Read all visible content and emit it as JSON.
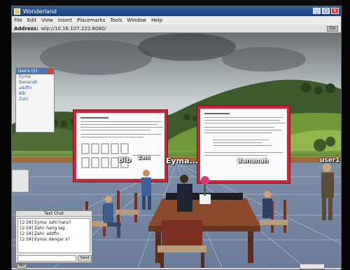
{
  "window": {
    "title": "Wonderland",
    "buttons": {
      "minimize": "_",
      "maximize": "□",
      "close": "x"
    }
  },
  "menu": {
    "items": [
      "File",
      "Edit",
      "View",
      "Insert",
      "Placemarks",
      "Tools",
      "Window",
      "Help"
    ]
  },
  "address": {
    "label": "Address:",
    "value": "wlp://10.16.107.222:8080/",
    "go_label": "Go"
  },
  "user_list": {
    "title": "Users (5)",
    "users": [
      "Eyma",
      "Bananah",
      "adzfin",
      "Bib",
      "Zahi"
    ]
  },
  "avatars": [
    {
      "name": "Bib"
    },
    {
      "name": "Zahi"
    },
    {
      "name": "Eyma..."
    },
    {
      "name": "Bananah"
    },
    {
      "name": "user1"
    }
  ],
  "chat": {
    "title": "Text Chat",
    "messages": [
      "[2:58] Eyma: zahi hanz?",
      "[2:58] Zahi: hang lag",
      "[2:58] Zahi: adzfin",
      "[2:58] Eyma: dengar x?"
    ],
    "input_value": "",
    "send_label": "Send"
  },
  "footer": {
    "left_button": "Pan"
  },
  "colors": {
    "board_border": "#c9283a",
    "titlebar": "#2f5f9f",
    "link": "#2b5aa8"
  }
}
